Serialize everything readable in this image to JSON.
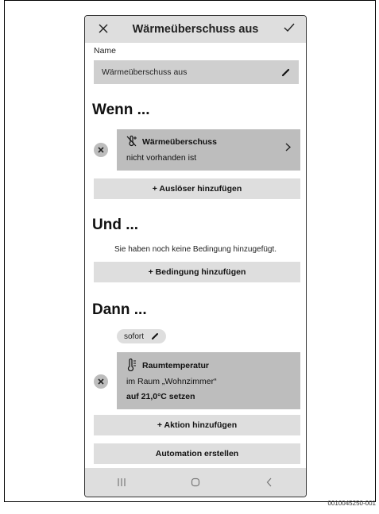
{
  "header": {
    "close_icon": "close-icon",
    "title": "Wärmeüberschuss aus",
    "confirm_icon": "checkmark-icon"
  },
  "name": {
    "label": "Name",
    "value": "Wärmeüberschuss aus",
    "edit_icon": "pencil-icon"
  },
  "trigger_section": {
    "heading": "Wenn ...",
    "item": {
      "icon": "heat-surplus-off-icon",
      "title": "Wärmeüberschuss",
      "subtitle": "nicht vorhanden ist",
      "remove_icon": "remove-icon",
      "open_icon": "chevron-right-icon"
    },
    "add_label": "+ Auslöser hinzufügen"
  },
  "condition_section": {
    "heading": "Und ...",
    "empty_text": "Sie haben noch keine Bedingung hinzugefügt.",
    "add_label": "+ Bedingung hinzufügen"
  },
  "action_section": {
    "heading": "Dann ...",
    "timing_chip": "sofort",
    "item": {
      "icon": "thermometer-icon",
      "title": "Raumtemperatur",
      "room": "im Raum „Wohnzimmer“",
      "setting": "auf 21,0°C setzen",
      "remove_icon": "remove-icon"
    },
    "add_label": "+ Aktion hinzufügen"
  },
  "create_button": "Automation erstellen",
  "navbar": {
    "recents_icon": "recents-icon",
    "home_icon": "home-icon",
    "back_icon": "back-icon"
  },
  "figure_id": "0010045250-001",
  "colors": {
    "bar_gray": "#dedede",
    "card_gray": "#bdbdbd",
    "field_gray": "#cfcfcf"
  }
}
